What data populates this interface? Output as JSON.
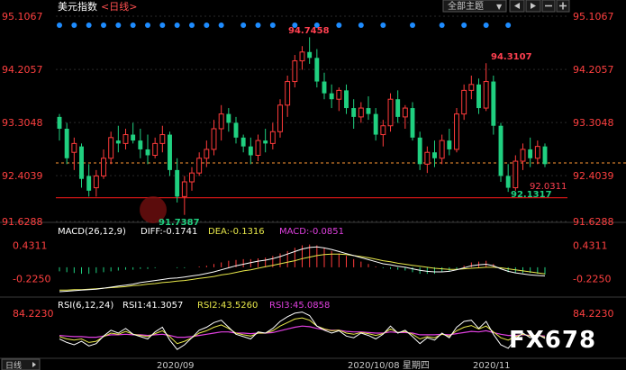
{
  "header": {
    "title": "美元指数",
    "period": "<日线>",
    "theme_label": "全部主题",
    "theme_arrow": "▼"
  },
  "colors": {
    "bg": "#000000",
    "up": "#ff3b3b",
    "down": "#20d080",
    "axis_text": "#ff4040",
    "grid": "#2a2a2a",
    "macd_diff": "#ffffff",
    "macd_dea": "#e8e84a",
    "macd_label": "#e040e0",
    "rsi1": "#ffffff",
    "rsi2": "#e8e84a",
    "rsi3": "#e040e0",
    "dot": "#1e8cff",
    "price_line": "#ff9933",
    "support_line": "#d01515"
  },
  "chart_data": [
    {
      "type": "candlestick",
      "title": "美元指数 <日线>",
      "y_ticks": [
        "95.1067",
        "94.2057",
        "93.3048",
        "92.4039",
        "91.6288"
      ],
      "ylim": [
        91.6288,
        95.1067
      ],
      "x_ticks": [
        "2020/09",
        "2020/10/08 星期四",
        "2020/11"
      ],
      "annotations": {
        "high_1": "94.7458",
        "high_2": "94.3107",
        "low_1": "91.7387",
        "low_2": "92.1317",
        "last_level": "92.0311"
      },
      "horizontal_levels": [
        92.0311
      ],
      "current_price_level": 92.62,
      "ohlc": [
        [
          93.4,
          93.45,
          93.0,
          93.2
        ],
        [
          93.2,
          93.3,
          92.6,
          92.7
        ],
        [
          92.8,
          93.05,
          92.5,
          92.95
        ],
        [
          92.9,
          92.95,
          92.2,
          92.35
        ],
        [
          92.4,
          92.6,
          92.05,
          92.15
        ],
        [
          92.2,
          92.5,
          92.05,
          92.4
        ],
        [
          92.4,
          92.85,
          92.35,
          92.7
        ],
        [
          92.7,
          93.15,
          92.6,
          93.05
        ],
        [
          93.0,
          93.25,
          92.8,
          92.95
        ],
        [
          92.95,
          93.2,
          92.85,
          93.1
        ],
        [
          93.1,
          93.3,
          92.95,
          93.0
        ],
        [
          93.0,
          93.2,
          92.7,
          92.85
        ],
        [
          92.85,
          93.1,
          92.6,
          92.75
        ],
        [
          92.75,
          93.05,
          92.7,
          92.95
        ],
        [
          92.95,
          93.25,
          92.8,
          93.1
        ],
        [
          93.1,
          93.15,
          92.4,
          92.5
        ],
        [
          92.5,
          92.7,
          91.95,
          92.05
        ],
        [
          92.05,
          92.4,
          91.74,
          92.3
        ],
        [
          92.3,
          92.55,
          92.15,
          92.45
        ],
        [
          92.45,
          92.8,
          92.4,
          92.7
        ],
        [
          92.7,
          93.0,
          92.55,
          92.85
        ],
        [
          92.85,
          93.35,
          92.75,
          93.2
        ],
        [
          93.2,
          93.6,
          93.0,
          93.45
        ],
        [
          93.45,
          93.55,
          93.15,
          93.3
        ],
        [
          93.3,
          93.4,
          92.95,
          93.05
        ],
        [
          93.05,
          93.1,
          92.8,
          92.9
        ],
        [
          92.9,
          93.05,
          92.6,
          92.75
        ],
        [
          92.75,
          93.1,
          92.65,
          93.0
        ],
        [
          93.0,
          93.2,
          92.8,
          92.95
        ],
        [
          92.95,
          93.3,
          92.85,
          93.15
        ],
        [
          93.15,
          93.7,
          93.05,
          93.6
        ],
        [
          93.6,
          94.1,
          93.4,
          94.0
        ],
        [
          94.0,
          94.45,
          93.9,
          94.35
        ],
        [
          94.35,
          94.6,
          94.2,
          94.5
        ],
        [
          94.5,
          94.75,
          94.3,
          94.4
        ],
        [
          94.4,
          94.55,
          93.9,
          94.0
        ],
        [
          94.0,
          94.15,
          93.7,
          93.8
        ],
        [
          93.8,
          93.95,
          93.55,
          93.7
        ],
        [
          93.7,
          93.9,
          93.5,
          93.85
        ],
        [
          93.85,
          93.95,
          93.45,
          93.55
        ],
        [
          93.55,
          93.7,
          93.2,
          93.4
        ],
        [
          93.4,
          93.65,
          93.3,
          93.55
        ],
        [
          93.55,
          93.75,
          93.35,
          93.45
        ],
        [
          93.45,
          93.55,
          93.0,
          93.1
        ],
        [
          93.1,
          93.35,
          92.9,
          93.25
        ],
        [
          93.25,
          93.8,
          93.15,
          93.7
        ],
        [
          93.7,
          93.85,
          93.3,
          93.4
        ],
        [
          93.4,
          93.6,
          93.2,
          93.55
        ],
        [
          93.55,
          93.65,
          93.0,
          93.05
        ],
        [
          93.05,
          93.15,
          92.5,
          92.6
        ],
        [
          92.6,
          92.9,
          92.45,
          92.8
        ],
        [
          92.8,
          93.0,
          92.55,
          92.7
        ],
        [
          92.7,
          93.1,
          92.6,
          93.0
        ],
        [
          93.0,
          93.2,
          92.75,
          92.85
        ],
        [
          92.85,
          93.55,
          92.8,
          93.45
        ],
        [
          93.45,
          93.95,
          93.35,
          93.85
        ],
        [
          93.85,
          94.1,
          93.7,
          93.95
        ],
        [
          93.95,
          94.05,
          93.45,
          93.55
        ],
        [
          93.55,
          94.31,
          93.5,
          94.0
        ],
        [
          94.0,
          94.1,
          93.1,
          93.25
        ],
        [
          93.25,
          93.3,
          92.3,
          92.4
        ],
        [
          92.4,
          92.6,
          92.13,
          92.2
        ],
        [
          92.2,
          92.75,
          92.15,
          92.65
        ],
        [
          92.65,
          92.95,
          92.5,
          92.85
        ],
        [
          92.85,
          93.05,
          92.55,
          92.7
        ],
        [
          92.7,
          93.0,
          92.6,
          92.9
        ],
        [
          92.9,
          92.95,
          92.55,
          92.6
        ]
      ]
    },
    {
      "type": "line",
      "title": "MACD(26,12,9)",
      "legend": {
        "diff": "DIFF:-0.1741",
        "dea": "DEA:-0.1316",
        "macd": "MACD:-0.0851"
      },
      "y_ticks": [
        "0.4311",
        "-0.2250"
      ],
      "ylim": [
        -0.55,
        0.6
      ],
      "histogram": [
        -0.05,
        -0.06,
        -0.07,
        -0.08,
        -0.08,
        -0.07,
        -0.06,
        -0.05,
        -0.04,
        -0.03,
        -0.03,
        -0.02,
        -0.02,
        -0.01,
        0.0,
        0.0,
        -0.01,
        -0.01,
        0.0,
        0.01,
        0.02,
        0.04,
        0.06,
        0.08,
        0.09,
        0.1,
        0.1,
        0.11,
        0.12,
        0.14,
        0.17,
        0.2,
        0.24,
        0.27,
        0.28,
        0.27,
        0.24,
        0.2,
        0.17,
        0.14,
        0.1,
        0.07,
        0.04,
        0.01,
        -0.01,
        -0.02,
        -0.03,
        -0.04,
        -0.06,
        -0.08,
        -0.08,
        -0.08,
        -0.06,
        -0.05,
        -0.02,
        0.02,
        0.06,
        0.07,
        0.08,
        0.04,
        -0.02,
        -0.06,
        -0.07,
        -0.07,
        -0.07,
        -0.08,
        -0.09
      ],
      "diff": [
        -0.48,
        -0.47,
        -0.46,
        -0.45,
        -0.44,
        -0.43,
        -0.41,
        -0.39,
        -0.37,
        -0.35,
        -0.33,
        -0.3,
        -0.28,
        -0.26,
        -0.24,
        -0.22,
        -0.21,
        -0.19,
        -0.17,
        -0.15,
        -0.12,
        -0.09,
        -0.05,
        -0.01,
        0.03,
        0.06,
        0.09,
        0.12,
        0.14,
        0.17,
        0.21,
        0.26,
        0.31,
        0.36,
        0.39,
        0.4,
        0.38,
        0.35,
        0.31,
        0.27,
        0.23,
        0.19,
        0.15,
        0.11,
        0.07,
        0.05,
        0.02,
        0.0,
        -0.03,
        -0.06,
        -0.08,
        -0.09,
        -0.09,
        -0.08,
        -0.05,
        -0.01,
        0.03,
        0.05,
        0.06,
        0.03,
        -0.03,
        -0.08,
        -0.11,
        -0.13,
        -0.15,
        -0.16,
        -0.17
      ],
      "dea": [
        -0.45,
        -0.45,
        -0.44,
        -0.44,
        -0.43,
        -0.42,
        -0.41,
        -0.4,
        -0.39,
        -0.38,
        -0.36,
        -0.35,
        -0.33,
        -0.32,
        -0.3,
        -0.29,
        -0.27,
        -0.26,
        -0.24,
        -0.22,
        -0.2,
        -0.18,
        -0.15,
        -0.13,
        -0.1,
        -0.07,
        -0.05,
        -0.02,
        0.01,
        0.04,
        0.07,
        0.1,
        0.13,
        0.17,
        0.2,
        0.23,
        0.25,
        0.26,
        0.26,
        0.25,
        0.23,
        0.21,
        0.19,
        0.16,
        0.13,
        0.11,
        0.08,
        0.06,
        0.04,
        0.02,
        0.0,
        -0.02,
        -0.03,
        -0.04,
        -0.04,
        -0.03,
        -0.02,
        -0.01,
        0.0,
        0.0,
        -0.01,
        -0.03,
        -0.05,
        -0.07,
        -0.09,
        -0.11,
        -0.13
      ]
    },
    {
      "type": "line",
      "title": "RSI(6,12,24)",
      "legend": {
        "rsi1": "RSI1:41.3057",
        "rsi2": "RSI2:43.5260",
        "rsi3": "RSI3:45.0858"
      },
      "y_ticks": [
        "84.2230"
      ],
      "ylim": [
        10,
        90
      ],
      "rsi1": [
        40,
        34,
        30,
        36,
        28,
        32,
        45,
        55,
        50,
        58,
        48,
        44,
        40,
        52,
        60,
        38,
        22,
        30,
        42,
        55,
        60,
        68,
        72,
        60,
        48,
        44,
        40,
        52,
        50,
        58,
        70,
        78,
        84,
        86,
        80,
        62,
        55,
        50,
        54,
        45,
        42,
        50,
        46,
        40,
        48,
        62,
        50,
        55,
        44,
        32,
        42,
        38,
        50,
        42,
        60,
        70,
        72,
        58,
        70,
        48,
        30,
        24,
        40,
        50,
        42,
        48,
        41
      ],
      "rsi2": [
        44,
        40,
        38,
        40,
        34,
        36,
        44,
        50,
        48,
        53,
        48,
        46,
        44,
        49,
        54,
        44,
        32,
        36,
        42,
        50,
        54,
        60,
        64,
        58,
        50,
        47,
        45,
        50,
        50,
        54,
        62,
        68,
        74,
        76,
        72,
        62,
        57,
        54,
        55,
        50,
        48,
        51,
        49,
        46,
        49,
        57,
        51,
        53,
        48,
        40,
        44,
        42,
        48,
        45,
        54,
        60,
        63,
        57,
        62,
        52,
        42,
        38,
        44,
        48,
        45,
        47,
        43
      ],
      "rsi3": [
        46,
        45,
        44,
        44,
        43,
        43,
        45,
        47,
        47,
        48,
        47,
        47,
        46,
        47,
        48,
        46,
        43,
        43,
        44,
        46,
        48,
        50,
        52,
        52,
        50,
        50,
        49,
        50,
        50,
        51,
        54,
        57,
        60,
        62,
        61,
        58,
        56,
        55,
        55,
        53,
        52,
        52,
        51,
        50,
        50,
        52,
        51,
        51,
        50,
        47,
        47,
        47,
        48,
        47,
        49,
        51,
        53,
        52,
        54,
        51,
        48,
        46,
        46,
        47,
        46,
        46,
        45
      ]
    }
  ],
  "watermark": "FX678",
  "footer": {
    "tab_label": "日线"
  }
}
